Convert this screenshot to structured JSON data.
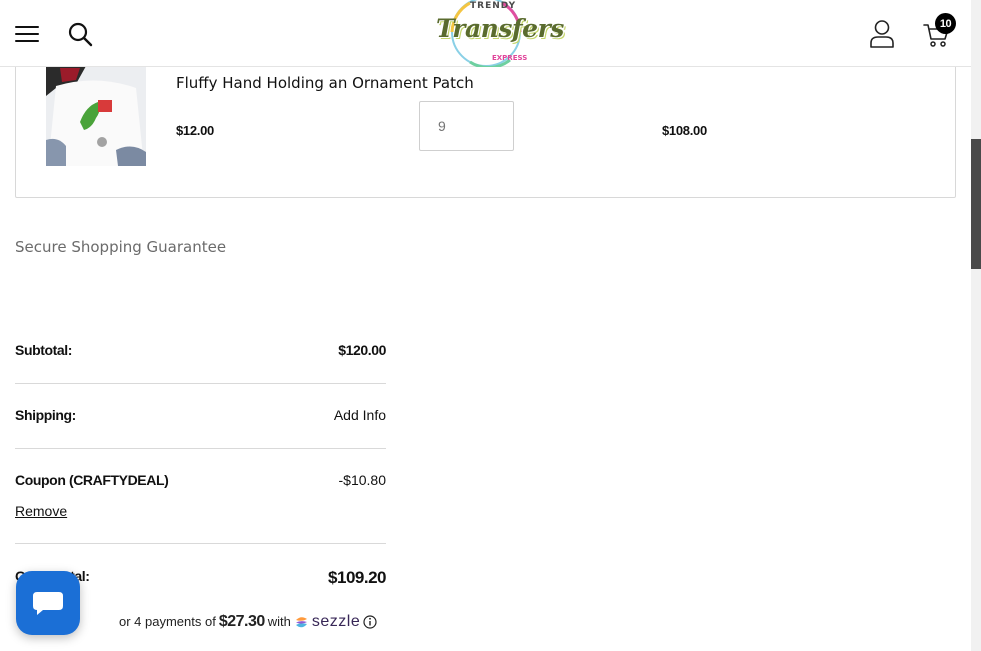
{
  "header": {
    "logo_top": "TRENDY",
    "logo_main": "Transfers",
    "cart_count": "10"
  },
  "cart_item": {
    "name": "Fluffy Hand Holding an Ornament Patch",
    "price": "$12.00",
    "quantity": "9",
    "total": "$108.00"
  },
  "secure_text": "Secure Shopping Guarantee",
  "summary": {
    "subtotal_label": "Subtotal:",
    "subtotal_value": "$120.00",
    "shipping_label": "Shipping:",
    "shipping_value": "Add Info",
    "coupon_label": "Coupon (CRAFTYDEAL)",
    "coupon_value": "-$10.80",
    "remove_label": "Remove",
    "grand_total_label": "Grand total:",
    "grand_total_value": "$109.20"
  },
  "sezzle": {
    "prefix": "or 4 payments of",
    "amount": "$27.30",
    "with": "with",
    "brand": "sezzle"
  },
  "colors": {
    "chat_button": "#1b6fd6",
    "sezzle_brand": "#382757",
    "logo_green": "#5a6b2e"
  },
  "icons": [
    "menu-icon",
    "search-icon",
    "account-icon",
    "cart-icon",
    "chat-icon",
    "sezzle-logo-icon",
    "info-icon"
  ]
}
